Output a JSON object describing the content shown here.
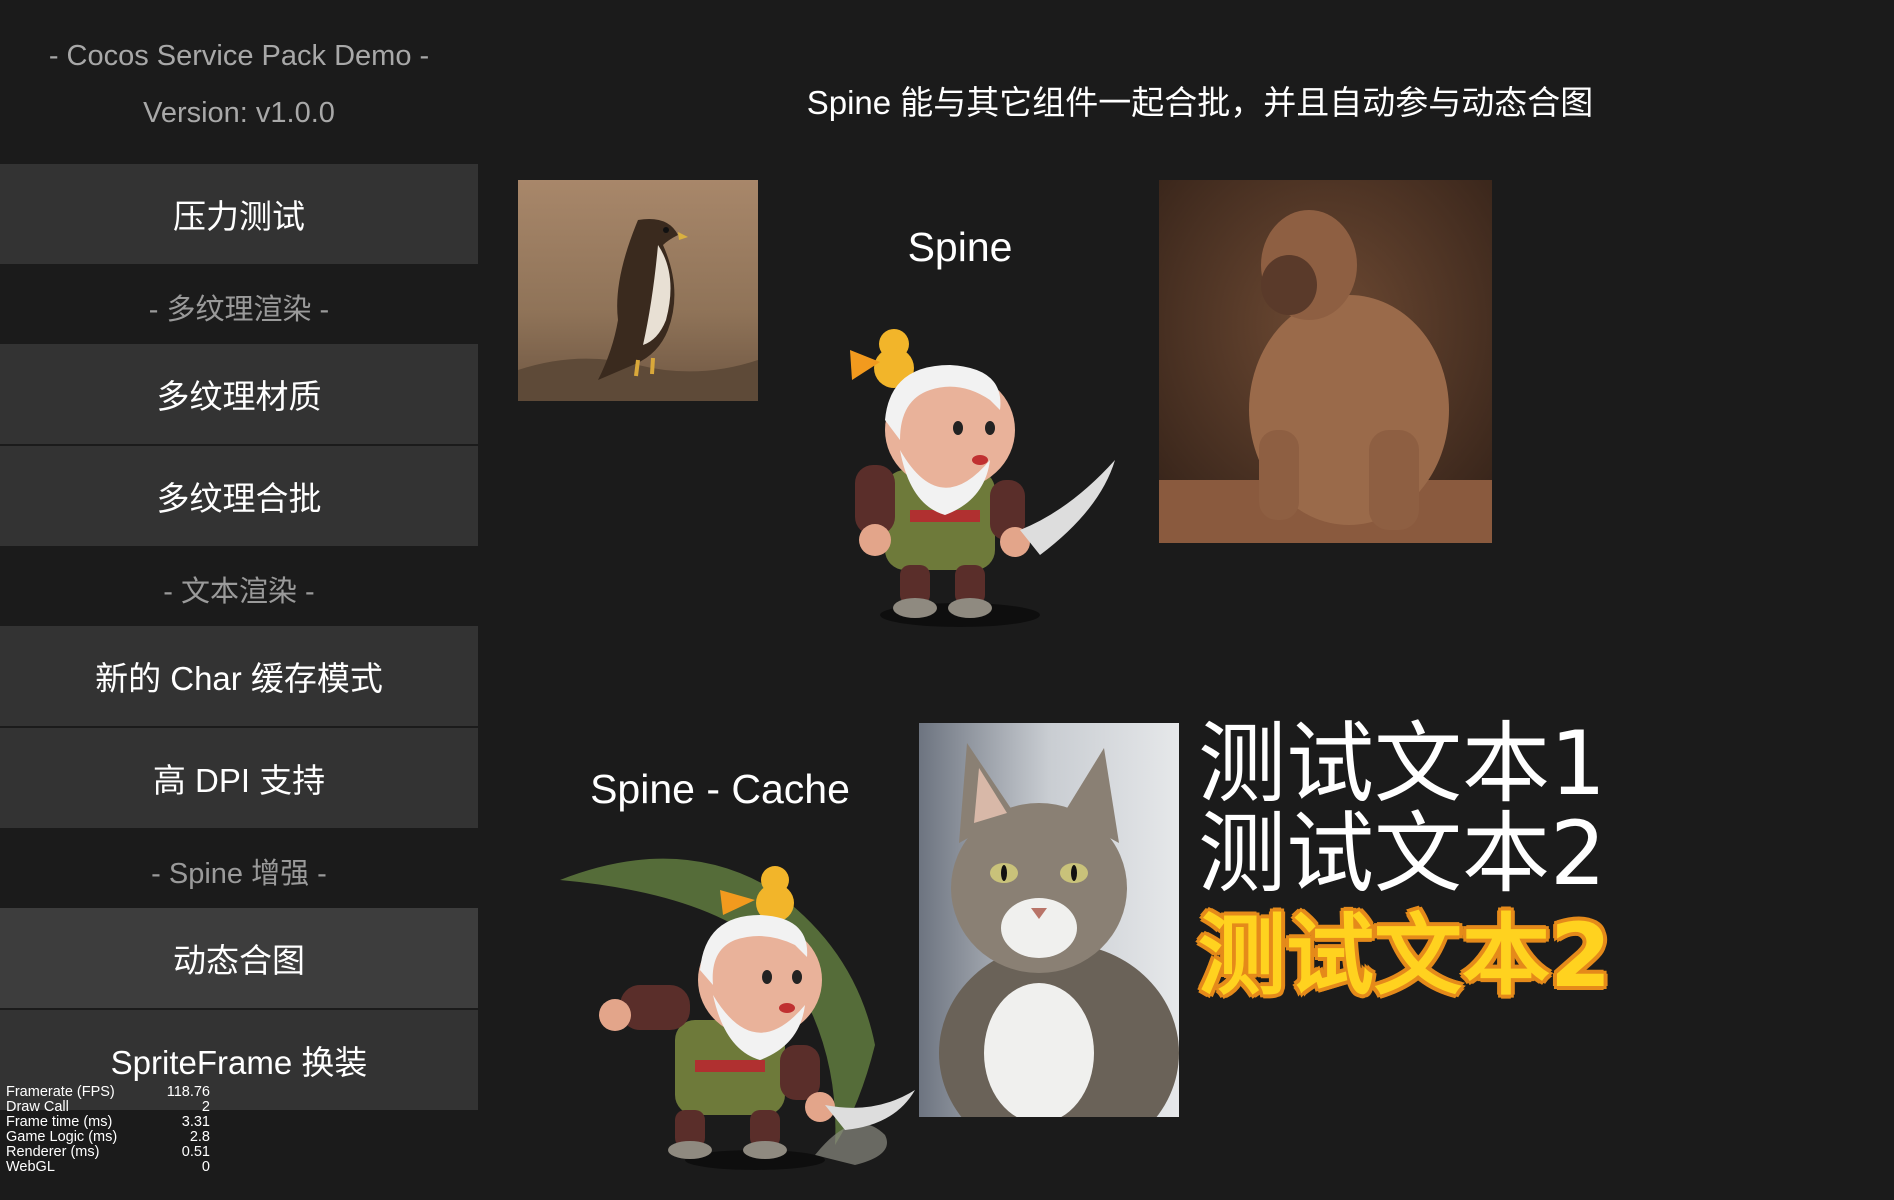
{
  "sidebar": {
    "title": "- Cocos Service Pack Demo -",
    "version": "Version: v1.0.0",
    "items": [
      {
        "type": "button",
        "label": "压力测试"
      },
      {
        "type": "section",
        "label": "- 多纹理渲染 -"
      },
      {
        "type": "button",
        "label": "多纹理材质"
      },
      {
        "type": "button",
        "label": "多纹理合批"
      },
      {
        "type": "section",
        "label": "- 文本渲染 -"
      },
      {
        "type": "button",
        "label": "新的 Char 缓存模式"
      },
      {
        "type": "button",
        "label": "高 DPI 支持"
      },
      {
        "type": "section",
        "label": "- Spine 增强 -"
      },
      {
        "type": "button",
        "label": "动态合图",
        "active": true
      },
      {
        "type": "button",
        "label": "SpriteFrame 换装"
      }
    ]
  },
  "stats": [
    {
      "label": "Framerate (FPS)",
      "value": "118.76"
    },
    {
      "label": "Draw Call",
      "value": "2"
    },
    {
      "label": "Frame time (ms)",
      "value": "3.31"
    },
    {
      "label": "Game Logic (ms)",
      "value": "2.8"
    },
    {
      "label": "Renderer (ms)",
      "value": "0.51"
    },
    {
      "label": "WebGL",
      "value": "0"
    }
  ],
  "main": {
    "header": "Spine 能与其它组件一起合批，并且自动参与动态合图",
    "spine_label": "Spine",
    "spine_cache_label": "Spine - Cache",
    "texts": [
      "测试文本1",
      "测试文本2",
      "测试文本2"
    ],
    "images": [
      "hawk-photo",
      "baboon-photo",
      "cat-photo"
    ]
  },
  "colors": {
    "background": "#1b1b1b",
    "button": "#333333",
    "button_active": "#3d3d3d",
    "muted_text": "#a8a8a8",
    "gold_text": "#ffd21f",
    "gold_outline": "#e58a1a"
  }
}
